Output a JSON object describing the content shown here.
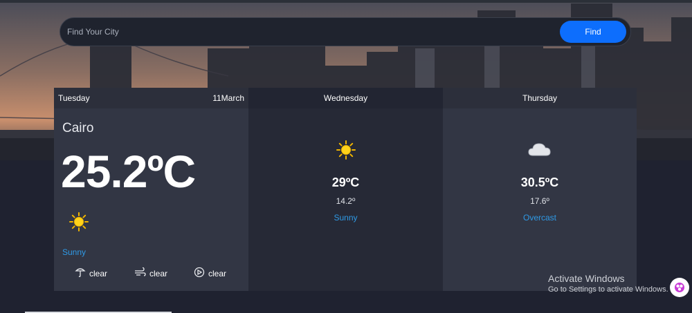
{
  "search": {
    "placeholder": "Find Your City",
    "button_label": "Find"
  },
  "today": {
    "day": "Tuesday",
    "date": "11March",
    "city": "Cairo",
    "temp": "25.2ºC",
    "condition": "Sunny",
    "icon": "sun-icon",
    "metrics": [
      {
        "icon": "umbrella-icon",
        "value": "clear"
      },
      {
        "icon": "wind-icon",
        "value": "clear"
      },
      {
        "icon": "compass-icon",
        "value": "clear"
      }
    ]
  },
  "forecast": [
    {
      "day": "Wednesday",
      "icon": "sun-icon",
      "max": "29ºC",
      "min": "14.2º",
      "condition": "Sunny"
    },
    {
      "day": "Thursday",
      "icon": "cloud-icon",
      "max": "30.5ºC",
      "min": "17.6º",
      "condition": "Overcast"
    }
  ],
  "watermark": {
    "line1": "Activate Windows",
    "line2": "Go to Settings to activate Windows."
  },
  "colors": {
    "accent": "#0d6efd",
    "condition_text": "#2f9ae6",
    "card": "#323644",
    "card_alt": "#262936",
    "page_bg": "#1f2230"
  }
}
